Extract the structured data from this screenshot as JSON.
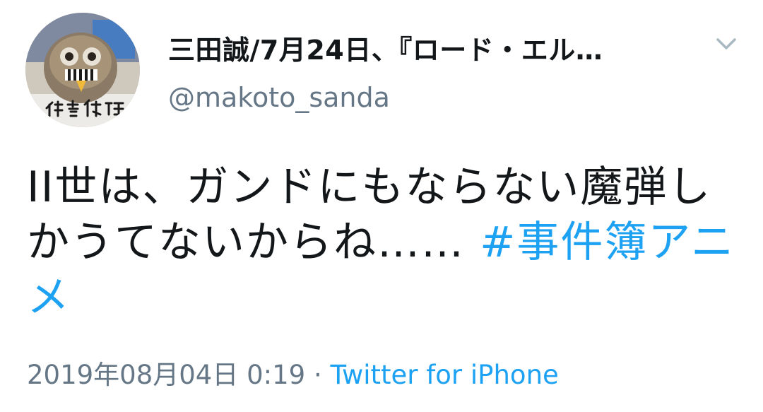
{
  "tweet": {
    "display_name": "三田誠/7月24日、『ロード・エル…",
    "handle": "@makoto_sanda",
    "text_main": "II世は、ガンドにもならない魔弾しかうてないからね……",
    "hashtag": "#事件簿アニメ",
    "timestamp": "2019年08月04日 0:19",
    "separator": "·",
    "source": "Twitter for iPhone",
    "avatar_caption": "作者代理"
  },
  "icons": {
    "caret": "chevron-down-icon",
    "avatar": "owl-avatar-icon"
  },
  "colors": {
    "link": "#1da1f2",
    "secondary": "#657786",
    "primary": "#14171a"
  }
}
